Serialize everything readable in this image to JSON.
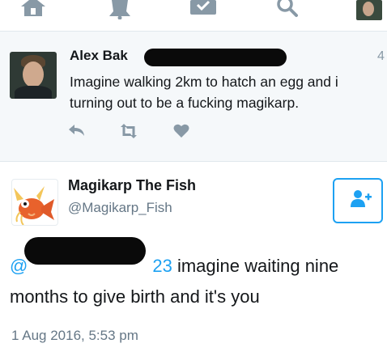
{
  "nav": {
    "icons": [
      "home-icon",
      "notifications-icon",
      "messages-icon",
      "search-icon",
      "profile-avatar"
    ]
  },
  "reply_tweet": {
    "time": "4",
    "text_line1": "Imagine walking 2km to hatch an egg and i",
    "text_line2": "turning out to be a fucking magikarp.",
    "actions": [
      "reply-icon",
      "retweet-icon",
      "like-icon"
    ]
  },
  "main_tweet": {
    "display_name": "Magikarp The Fish",
    "handle": "@Magikarp_Fish",
    "mention_prefix": "@",
    "mention_suffix": "23",
    "text_after_mention": " imagine waiting nine",
    "text_line2": "months to give birth and it's you",
    "timestamp": "1 Aug 2016, 5:53 pm",
    "follow_icon": "add-user-icon"
  },
  "colors": {
    "accent": "#1da1f2",
    "secondary_text": "#657786",
    "muted_icon": "#8899a6",
    "reply_background": "#f5f8fa"
  }
}
